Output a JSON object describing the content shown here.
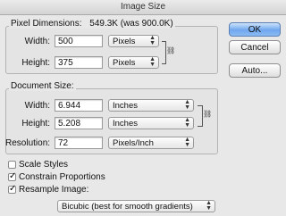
{
  "window": {
    "title": "Image Size"
  },
  "pixel_dimensions": {
    "label": "Pixel Dimensions:",
    "size": "549.3K (was 900.0K)",
    "width": {
      "label": "Width:",
      "value": "500",
      "unit": "Pixels"
    },
    "height": {
      "label": "Height:",
      "value": "375",
      "unit": "Pixels"
    }
  },
  "document_size": {
    "label": "Document Size:",
    "width": {
      "label": "Width:",
      "value": "6.944",
      "unit": "Inches"
    },
    "height": {
      "label": "Height:",
      "value": "5.208",
      "unit": "Inches"
    },
    "resolution": {
      "label": "Resolution:",
      "value": "72",
      "unit": "Pixels/Inch"
    }
  },
  "options": {
    "scale_styles": {
      "label": "Scale Styles",
      "checked": false
    },
    "constrain_proportions": {
      "label": "Constrain Proportions",
      "checked": true
    },
    "resample_image": {
      "label": "Resample Image:",
      "checked": true
    },
    "resample_method": "Bicubic (best for smooth gradients)"
  },
  "buttons": {
    "ok": "OK",
    "cancel": "Cancel",
    "auto": "Auto..."
  },
  "icons": {
    "chain": "chain-link-icon",
    "dropdown": "updown-arrows-icon"
  }
}
